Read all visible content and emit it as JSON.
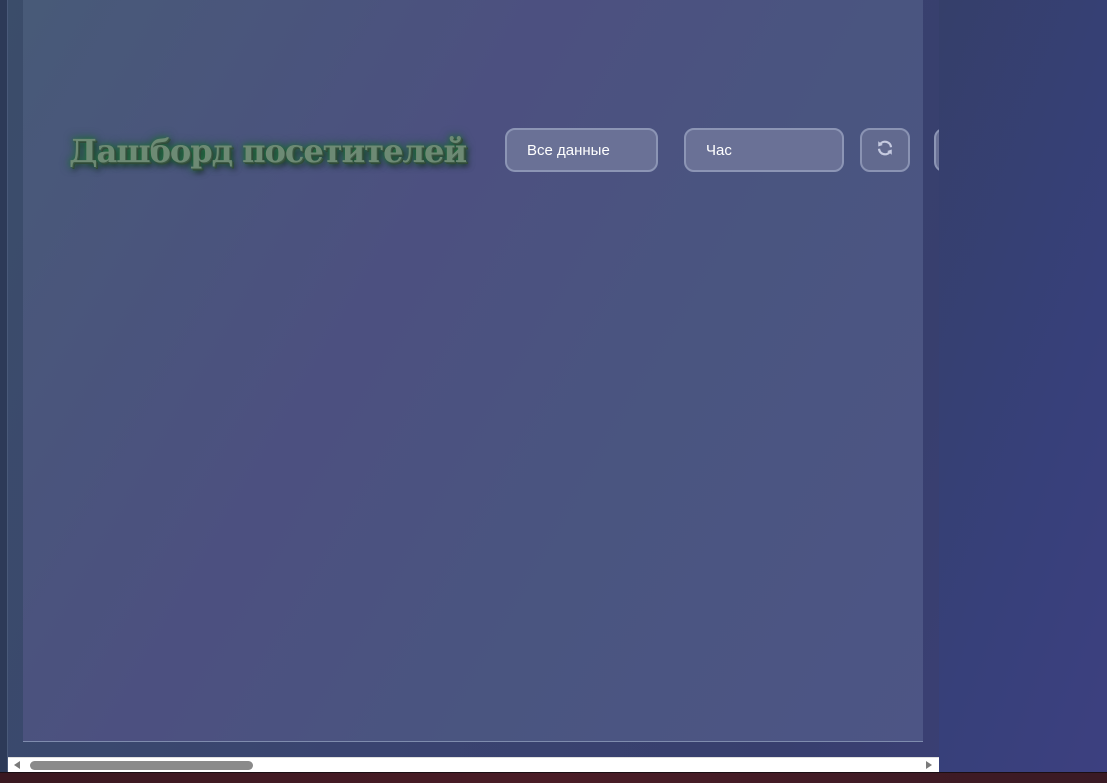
{
  "dashboard": {
    "title": "Дашборд посетителей"
  },
  "controls": {
    "data_filter": {
      "selected": "Все данные"
    },
    "period_filter": {
      "selected": "Час"
    },
    "refresh_icon": "refresh-icon",
    "extra_icon": "search-icon"
  },
  "colors": {
    "title_glow": "#1f7a3a",
    "control_bg": "#6a7196",
    "panel_bg": "#4a5580"
  },
  "scrollbar": {
    "horizontal_position": 0
  }
}
